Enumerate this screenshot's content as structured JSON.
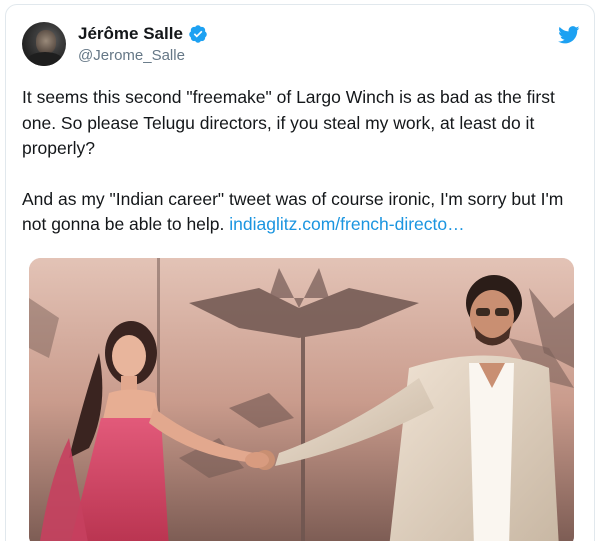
{
  "tweet": {
    "author": {
      "display_name": "Jérôme Salle",
      "handle": "@Jerome_Salle",
      "verified": true,
      "avatar_icon": "user-avatar",
      "verified_icon": "verified-badge-icon"
    },
    "platform_icon": "twitter-bird-icon",
    "text": {
      "paragraph_1": "It seems this second \"freemake\" of Largo Winch is as bad as the first one. So please Telugu directors, if you steal my work, at least do it properly?",
      "paragraph_2_text": "And as my \"Indian career\" tweet was of course ironic, I'm sorry but I'm not gonna be able to help. ",
      "paragraph_2_link": "indiaglitz.com/french-directo…"
    },
    "media": {
      "type": "image",
      "description_icon": "movie-poster-image"
    }
  },
  "colors": {
    "link": "#1b95e0",
    "handle": "#657786",
    "text": "#14171a",
    "verified": "#1da1f2",
    "bird": "#1da1f2"
  }
}
